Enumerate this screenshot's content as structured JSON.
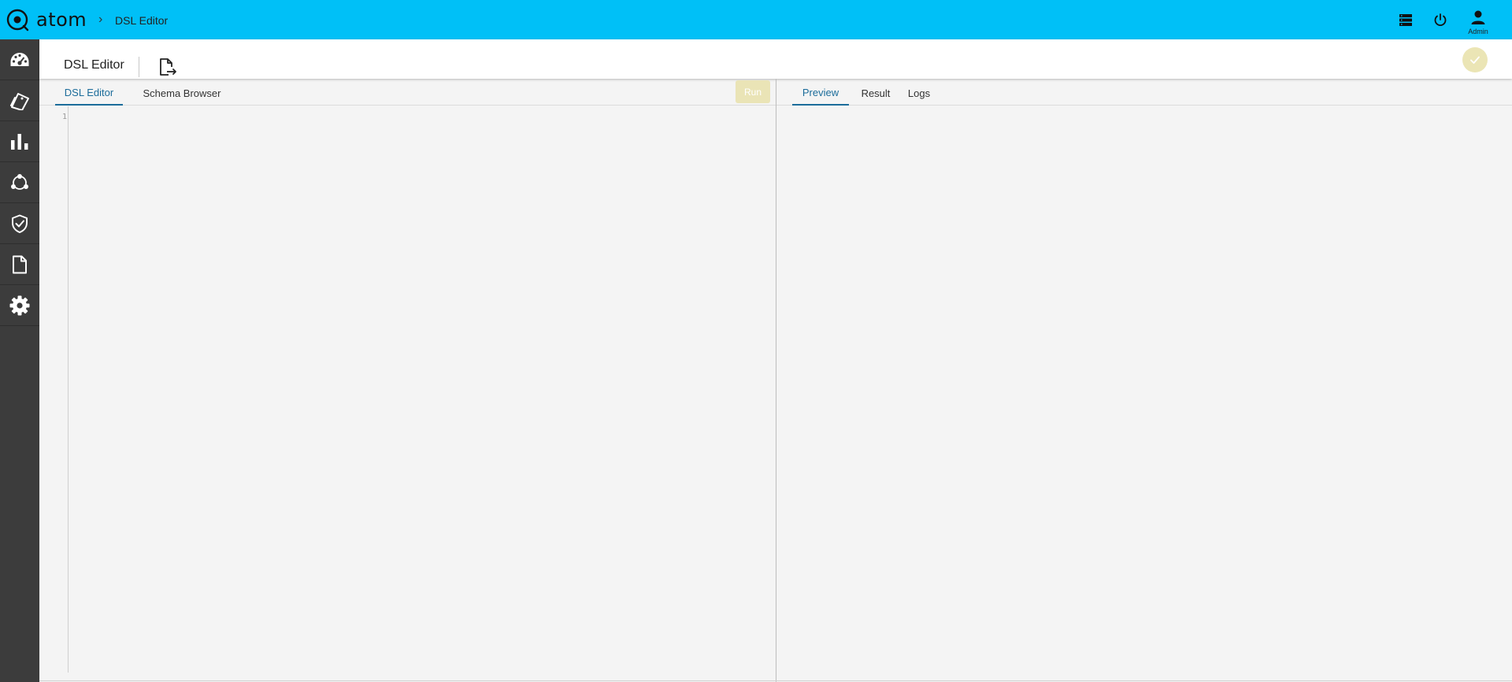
{
  "app": {
    "brand": "atom"
  },
  "breadcrumb": {
    "separator": "›",
    "current": "DSL Editor"
  },
  "header_icons": [
    "list-icon",
    "power-icon",
    "user-icon"
  ],
  "user": {
    "label": "Admin"
  },
  "sidebar": {
    "items": [
      {
        "icon": "dashboard-icon"
      },
      {
        "icon": "tickets-icon"
      },
      {
        "icon": "bar-chart-icon"
      },
      {
        "icon": "network-icon"
      },
      {
        "icon": "shield-check-icon"
      },
      {
        "icon": "document-icon"
      },
      {
        "icon": "gear-icon"
      }
    ]
  },
  "toolbar": {
    "title": "DSL Editor",
    "export_icon": "file-export-icon",
    "confirm_icon": "check-icon"
  },
  "left_pane": {
    "tabs": [
      {
        "label": "DSL Editor",
        "active": true
      },
      {
        "label": "Schema Browser",
        "active": false
      }
    ],
    "run_label": "Run",
    "line_numbers": [
      "1"
    ],
    "code": ""
  },
  "right_pane": {
    "tabs": [
      {
        "label": "Preview",
        "active": true
      },
      {
        "label": "Result",
        "active": false
      },
      {
        "label": "Logs",
        "active": false
      }
    ]
  },
  "colors": {
    "topbar": "#00c0f7",
    "sidebar": "#3c3c3c",
    "accent": "#1b6c9a",
    "run_button": "#eae4b6"
  }
}
